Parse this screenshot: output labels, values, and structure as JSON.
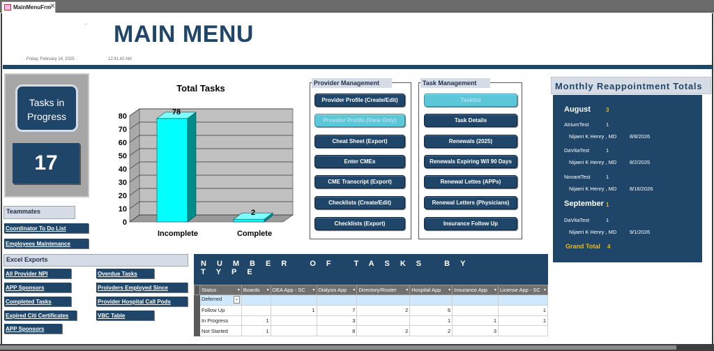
{
  "tab": {
    "label": "MainMenuFrm",
    "close": "✕"
  },
  "header": {
    "title": "MAIN MENU",
    "date": "Friday, February 14, 2025",
    "time": "12:41:42 AM",
    "mark": "."
  },
  "tasks_in_progress": {
    "label_line1": "Tasks in",
    "label_line2": "Progress",
    "count": "17"
  },
  "teammates": {
    "heading": "Teammates",
    "links": [
      "Coordinator To Do List",
      "Employees Maintenance"
    ]
  },
  "excel_exports": {
    "heading": "Excel Exports",
    "left_links": [
      "All Provider NPI",
      "APP Sponsors",
      "Completed Tasks",
      "Expired Citi Certificates",
      "APP Sponsors"
    ],
    "right_links": [
      "Overdue Tasks",
      "Proivders Employed Since",
      "Provider Hospital Call Pods",
      "VBC Table"
    ]
  },
  "chart_data": {
    "type": "bar",
    "title": "Total Tasks",
    "categories": [
      "Incomplete",
      "Complete"
    ],
    "values": [
      78,
      2
    ],
    "data_labels": [
      "78",
      "2"
    ],
    "ylim": [
      0,
      80
    ],
    "yticks": [
      "0",
      "10",
      "20",
      "30",
      "40",
      "50",
      "60",
      "70",
      "80"
    ],
    "grid": true,
    "style": "3d",
    "colors": {
      "bar": "#00ffff",
      "bar_side": "#008b8b",
      "wall": "#c0c0c0"
    }
  },
  "provider_management": {
    "heading": "Provider Management",
    "buttons": [
      "Provider Profile (Create/Edit)",
      "Provider Profile (View Only)",
      "Cheat Sheet (Export)",
      "Enter CMEs",
      "CME Transcript (Export)",
      "Checklists (Create/Edit)",
      "Checklists (Export)"
    ]
  },
  "task_management": {
    "heading": "Task Management",
    "buttons": [
      "Tasklist",
      "Task Details",
      "Renewals (2025)",
      "Renewals Expiring W/I 90 Days",
      "Renewal Lettes (APPs)",
      "Renewal Letters (Physicians)",
      "Insurance Follow Up"
    ]
  },
  "monthly": {
    "title": "Monthly Reappointment Totals",
    "august": {
      "month": "August",
      "count": "3"
    },
    "a1": {
      "facility": "AtriumTest",
      "n": "1",
      "provider": "Nijaeri K Henry , MD",
      "date": "8/8/2026"
    },
    "a2": {
      "facility": "DaVitaTest",
      "n": "1",
      "provider": "Nijaeri K Henry , MD",
      "date": "8/2/2025"
    },
    "a3": {
      "facility": "NovantTest",
      "n": "1",
      "provider": "Nijaeri K Henry , MD",
      "date": "8/16/2026"
    },
    "september": {
      "month": "September",
      "count": "1"
    },
    "s1": {
      "facility": "DaVitaTest",
      "n": "1",
      "provider": "Nijaeri K Henry , MD",
      "date": "9/1/2026"
    },
    "grand_total": {
      "label": "Grand Total",
      "value": "4"
    }
  },
  "tasks_by_type": {
    "heading": "NUMBER OF TASKS BY TYPE",
    "columns": [
      "Status",
      "Boards",
      "DEA App - SC",
      "Dialysis App",
      "Directory/Roster",
      "Hospital App",
      "Insurance App",
      "License App - SC"
    ],
    "rows": [
      {
        "status": "Deferred",
        "cells": [
          "",
          "",
          "",
          "",
          "",
          "",
          ""
        ]
      },
      {
        "status": "Follow Up",
        "cells": [
          "",
          "1",
          "7",
          "2",
          "6",
          "",
          "1"
        ]
      },
      {
        "status": "In Progress",
        "cells": [
          "1",
          "",
          "3",
          "",
          "1",
          "1",
          "1"
        ]
      },
      {
        "status": "Not Started",
        "cells": [
          "1",
          "",
          "8",
          "2",
          "2",
          "3",
          ""
        ]
      }
    ],
    "dropdown_glyph": "⌄"
  },
  "colors": {
    "navy": "#1f4569",
    "gold": "#f5b800",
    "cyan": "#00ffff"
  }
}
